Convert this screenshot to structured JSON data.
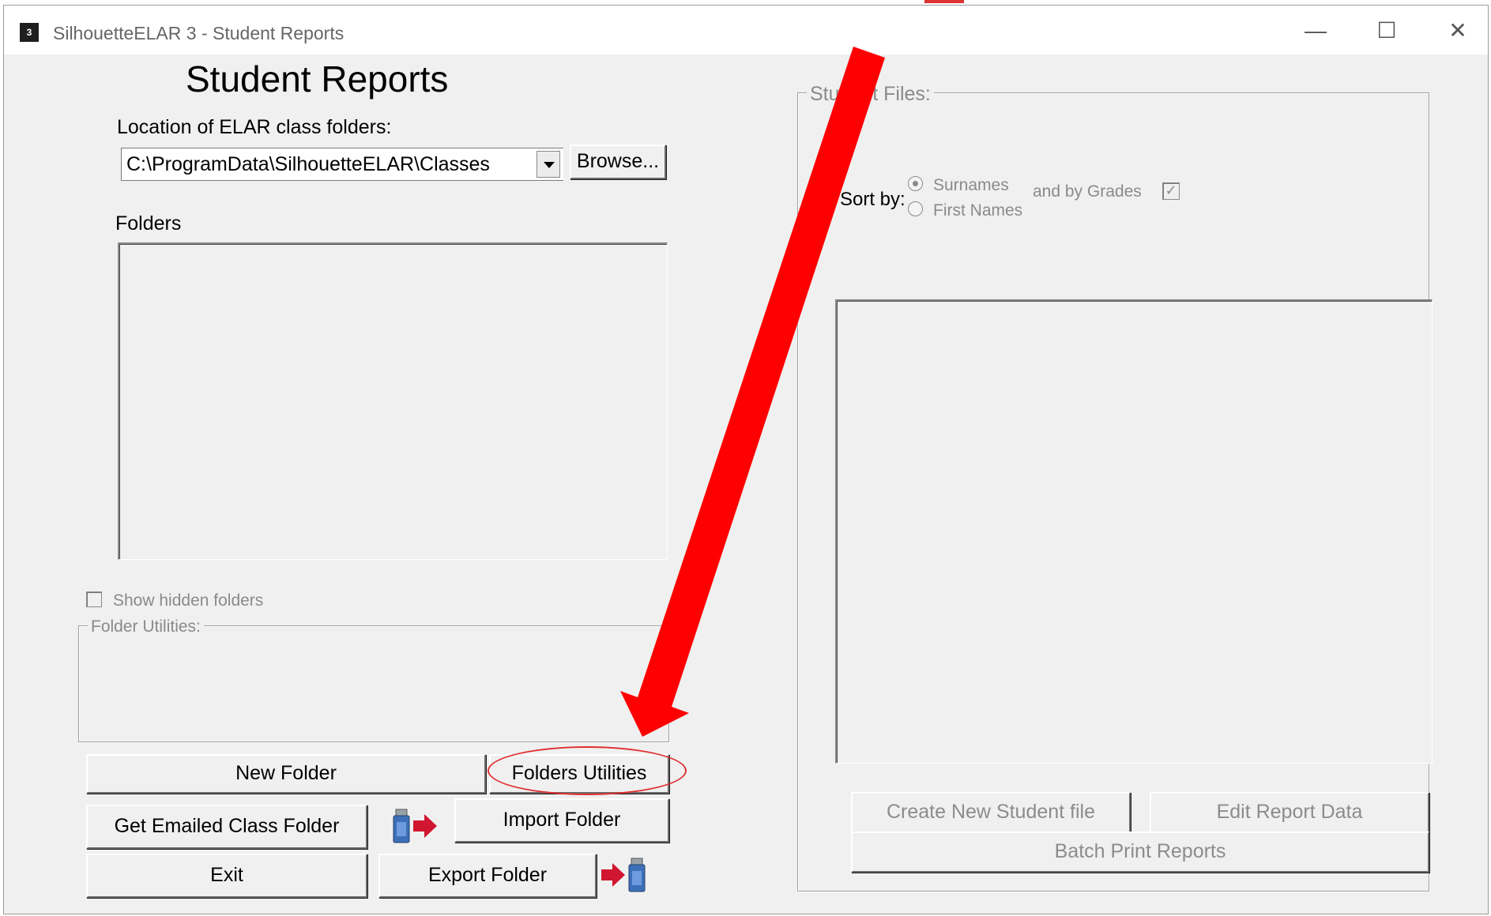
{
  "window": {
    "app_icon_text": "3",
    "title": "SilhouetteELAR 3  - Student Reports",
    "controls": {
      "minimize": "—",
      "maximize": "☐",
      "close": "✕"
    }
  },
  "left": {
    "page_title": "Student Reports",
    "location_label": "Location of ELAR class folders:",
    "location_value": "C:\\ProgramData\\SilhouetteELAR\\Classes",
    "browse_button": "Browse...",
    "folders_label": "Folders",
    "show_hidden_label": "Show hidden folders",
    "folder_utilities_legend": "Folder Utilities:",
    "buttons": {
      "new_folder": "New Folder",
      "folders_utilities": "Folders Utilities",
      "get_emailed": "Get Emailed Class Folder",
      "import_folder": "Import Folder",
      "exit": "Exit",
      "export_folder": "Export Folder"
    }
  },
  "right": {
    "student_files_legend": "Student Files:",
    "sort_by_label": "Sort by:",
    "sort_options": [
      "Surnames",
      "First Names"
    ],
    "sort_selected": "Surnames",
    "and_by_grades_label": "and by Grades",
    "and_by_grades_checked": true,
    "buttons": {
      "create_new_student": "Create New Student file",
      "edit_report_data": "Edit Report Data",
      "batch_print": "Batch Print Reports"
    }
  },
  "annotation": {
    "arrow_color": "#ff0000",
    "highlight_color": "#e03030"
  }
}
